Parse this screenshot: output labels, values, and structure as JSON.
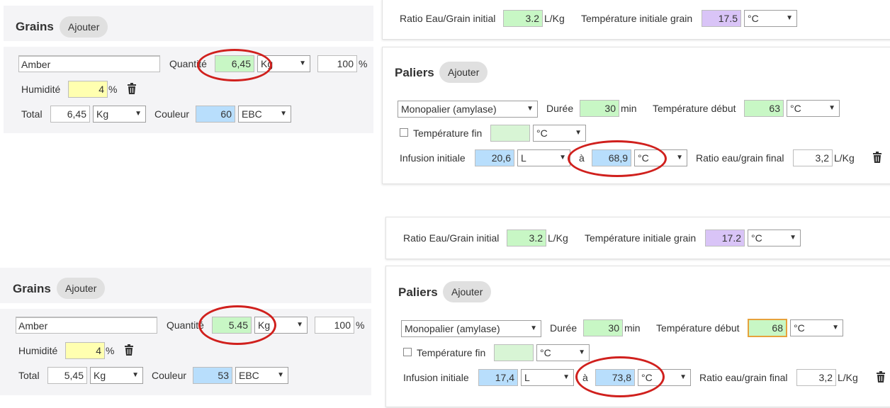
{
  "grains": {
    "title": "Grains",
    "add_button": "Ajouter",
    "name_value": "Amber",
    "quantity_label": "Quantité",
    "quantity_unit": "Kg",
    "percent_value": "100",
    "percent_sign": "%",
    "humidity_label": "Humidité",
    "humidity_value": "4",
    "humidity_unit": "%",
    "total_label": "Total",
    "total_unit": "Kg",
    "color_label": "Couleur",
    "color_unit": "EBC"
  },
  "grains_top": {
    "quantity_value": "6,45",
    "total_value": "6,45",
    "color_value": "60"
  },
  "grains_bottom": {
    "quantity_value": "5.45",
    "total_value": "5,45",
    "color_value": "53"
  },
  "ratio": {
    "ratio_label": "Ratio Eau/Grain initial",
    "ratio_value": "3.2",
    "ratio_unit": "L/Kg",
    "temp_label": "Température initiale grain",
    "temp_unit": "°C"
  },
  "ratio_top": {
    "temp_value": "17.5"
  },
  "ratio_bottom": {
    "temp_value": "17.2"
  },
  "paliers": {
    "title": "Paliers",
    "add_button": "Ajouter",
    "type_value": "Monopalier (amylase)",
    "duration_label": "Durée",
    "duration_value": "30",
    "duration_unit": "min",
    "start_temp_label": "Température début",
    "temp_unit": "°C",
    "end_temp_label": "Température fin",
    "infusion_label": "Infusion initiale",
    "infusion_unit": "L",
    "at_label": "à",
    "final_ratio_label": "Ratio eau/grain final",
    "final_ratio_value": "3,2",
    "final_ratio_unit": "L/Kg"
  },
  "paliers_top": {
    "start_temp_value": "63",
    "infusion_value": "20,6",
    "infusion_temp_value": "68,9"
  },
  "paliers_bottom": {
    "start_temp_value": "68",
    "infusion_value": "17,4",
    "infusion_temp_value": "73,8"
  },
  "icons": {
    "trash": "trash-icon",
    "dropdown": "chevron-down-icon"
  },
  "colors": {
    "green": "#c8f7c5",
    "yellow": "#ffffb0",
    "blue": "#b8defc",
    "purple": "#d9c4f7",
    "annotation": "#d0201d"
  }
}
